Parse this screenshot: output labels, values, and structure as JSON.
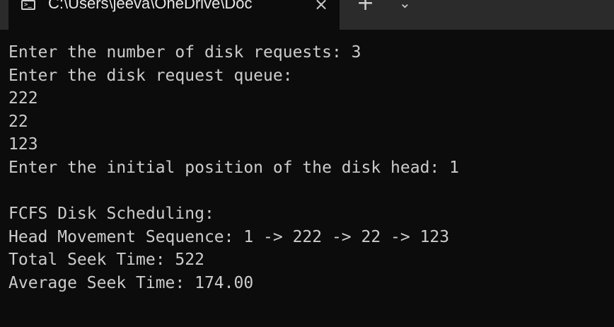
{
  "tab": {
    "title": "C:\\Users\\jeeva\\OneDrive\\Doc",
    "icon": "terminal-icon",
    "close": "×",
    "new_tab": "+",
    "dropdown": "⌄"
  },
  "console": {
    "lines": [
      "Enter the number of disk requests: 3",
      "Enter the disk request queue:",
      "222",
      "22",
      "123",
      "Enter the initial position of the disk head: 1",
      "",
      "FCFS Disk Scheduling:",
      "Head Movement Sequence: 1 -> 222 -> 22 -> 123",
      "Total Seek Time: 522",
      "Average Seek Time: 174.00"
    ]
  },
  "colors": {
    "background": "#0c0c0c",
    "tabbar": "#2b2b2b",
    "text": "#cccccc"
  }
}
